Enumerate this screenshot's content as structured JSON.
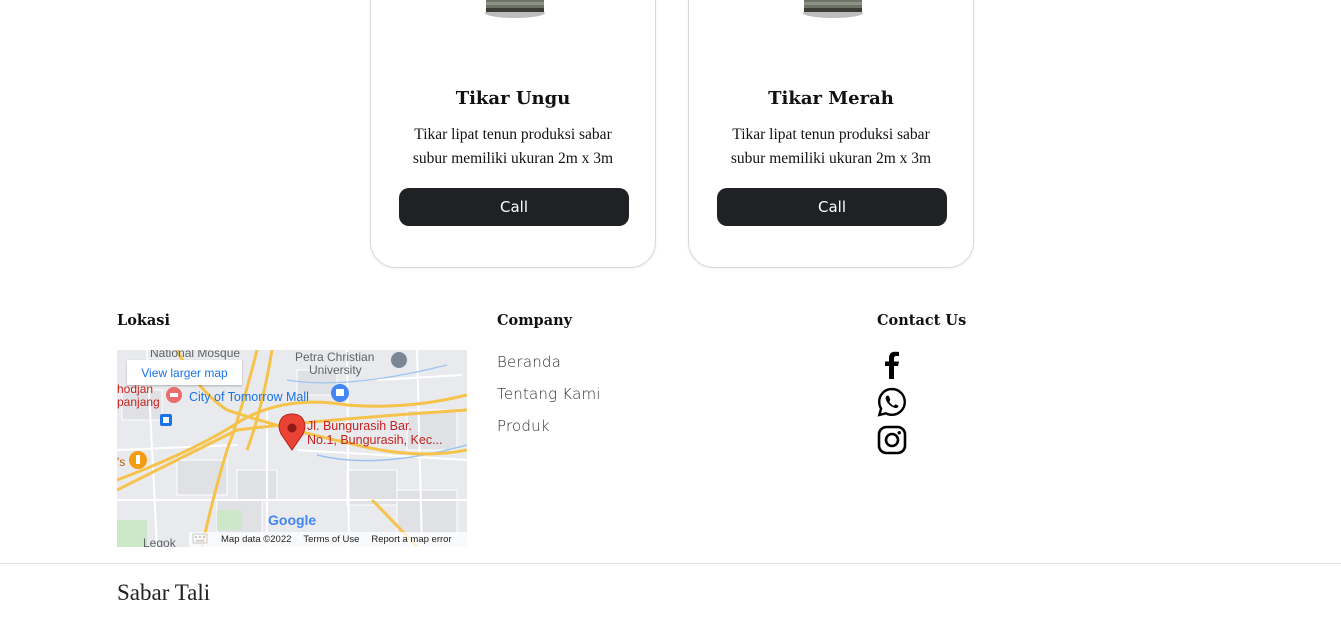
{
  "products": [
    {
      "name": "Tikar Ungu",
      "description": "Tikar lipat tenun produksi sabar subur memiliki ukuran 2m x 3m",
      "button_label": "Call"
    },
    {
      "name": "Tikar Merah",
      "description": "Tikar lipat tenun produksi sabar subur memiliki ukuran 2m x 3m",
      "button_label": "Call"
    }
  ],
  "footer": {
    "location": {
      "heading": "Lokasi",
      "map": {
        "view_larger_label": "View larger map",
        "place_labels": {
          "mosque": "National Mosque",
          "church": "Petra Christian",
          "university": "University",
          "mall": "City of Tomorrow Mall",
          "hospital_1": "hodjan",
          "hospital_2": "panjang",
          "restaurant": "'s",
          "pin_address_1": "Jl. Bungurasih Bar.",
          "pin_address_2": "No.1, Bungurasih, Kec...",
          "district": "Legok"
        },
        "google_logo": "Google",
        "map_data": "Map data ©2022",
        "terms": "Terms of Use",
        "report": "Report a map error"
      }
    },
    "company": {
      "heading": "Company",
      "links": [
        "Beranda",
        "Tentang Kami",
        "Produk"
      ]
    },
    "contact": {
      "heading": "Contact Us",
      "icons": [
        "facebook-icon",
        "whatsapp-icon",
        "instagram-icon"
      ]
    },
    "brand": "Sabar Tali"
  },
  "colors": {
    "button_bg": "#1f2124",
    "map_pin": "#ea4335",
    "map_road": "#f5c34b",
    "link_blue": "#1a73e8"
  }
}
